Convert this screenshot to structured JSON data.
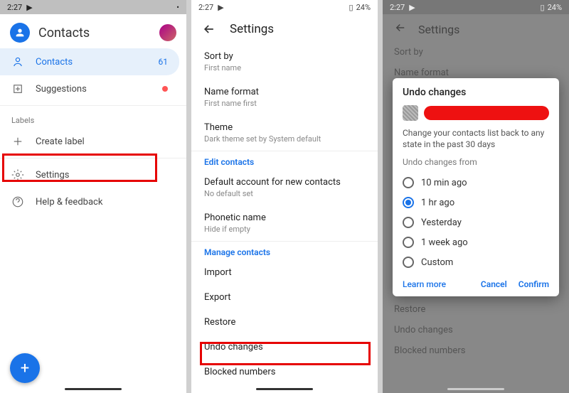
{
  "status": {
    "time": "2:27",
    "battery": "24%",
    "battery_icon": "battery-icon",
    "youtube_icon": "youtube-icon"
  },
  "screen1": {
    "title": "Contacts",
    "nav": {
      "contacts": {
        "label": "Contacts",
        "count": "61"
      },
      "suggestions": {
        "label": "Suggestions"
      }
    },
    "labels_header": "Labels",
    "create_label": "Create label",
    "settings": "Settings",
    "help": "Help & feedback"
  },
  "screen2": {
    "title": "Settings",
    "sort_by": {
      "label": "Sort by",
      "value": "First name"
    },
    "name_format": {
      "label": "Name format",
      "value": "First name first"
    },
    "theme": {
      "label": "Theme",
      "value": "Dark theme set by System default"
    },
    "edit_header": "Edit contacts",
    "default_account": {
      "label": "Default account for new contacts",
      "value": "No default set"
    },
    "phonetic": {
      "label": "Phonetic name",
      "value": "Hide if empty"
    },
    "manage_header": "Manage contacts",
    "import": "Import",
    "export": "Export",
    "restore": "Restore",
    "undo": "Undo changes",
    "blocked": "Blocked numbers"
  },
  "screen3": {
    "bg": {
      "title": "Settings",
      "sort_by": "Sort by",
      "name_format": "Name format",
      "restore": "Restore",
      "undo": "Undo changes",
      "blocked": "Blocked numbers"
    },
    "modal": {
      "title": "Undo changes",
      "desc": "Change your contacts list back to any state in the past 30 days",
      "sub": "Undo changes from",
      "options": {
        "o10min": "10 min ago",
        "o1hr": "1 hr ago",
        "oyesterday": "Yesterday",
        "o1week": "1 week ago",
        "ocustom": "Custom"
      },
      "learn_more": "Learn more",
      "cancel": "Cancel",
      "confirm": "Confirm"
    }
  }
}
